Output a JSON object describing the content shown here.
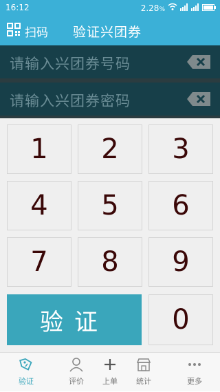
{
  "status_bar": {
    "time": "16:12",
    "battery_text": "2.28",
    "percent_symbol": "%"
  },
  "header": {
    "scan_label": "扫码",
    "title": "验证兴团券"
  },
  "inputs": {
    "coupon_number_placeholder": "请输入兴团券号码",
    "coupon_password_placeholder": "请输入兴团券密码"
  },
  "keypad": {
    "keys": [
      "1",
      "2",
      "3",
      "4",
      "5",
      "6",
      "7",
      "8",
      "9",
      "0"
    ],
    "verify_label": "验证"
  },
  "tabs": [
    {
      "label": "验证",
      "icon": "tag-icon",
      "active": true
    },
    {
      "label": "评价",
      "icon": "person-icon",
      "active": false
    },
    {
      "label": "上单",
      "icon": "plus-icon",
      "active": false
    },
    {
      "label": "统计",
      "icon": "shop-icon",
      "active": false
    },
    {
      "label": "更多",
      "icon": "more-dots-icon",
      "active": false
    }
  ],
  "colors": {
    "accent": "#3bb0d7",
    "verify_button": "#3aa6bb",
    "input_bg": "#173f49",
    "key_text": "#3a0707"
  }
}
